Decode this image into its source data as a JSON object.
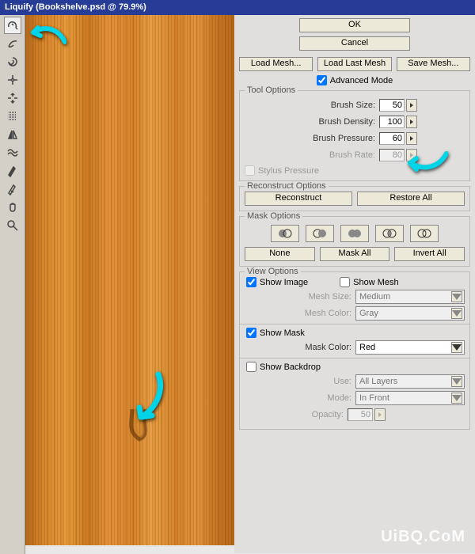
{
  "title": "Liquify (Bookshelve.psd @ 79.9%)",
  "buttons": {
    "ok": "OK",
    "cancel": "Cancel",
    "load_mesh": "Load Mesh...",
    "load_last_mesh": "Load Last Mesh",
    "save_mesh": "Save Mesh...",
    "reconstruct": "Reconstruct",
    "restore_all": "Restore All",
    "none": "None",
    "mask_all": "Mask All",
    "invert_all": "Invert All"
  },
  "advanced_mode_label": "Advanced Mode",
  "tool_options": {
    "legend": "Tool Options",
    "brush_size_label": "Brush Size:",
    "brush_size": "50",
    "brush_density_label": "Brush Density:",
    "brush_density": "100",
    "brush_pressure_label": "Brush Pressure:",
    "brush_pressure": "60",
    "brush_rate_label": "Brush Rate:",
    "brush_rate": "80",
    "stylus_label": "Stylus Pressure"
  },
  "reconstruct_options": {
    "legend": "Reconstruct Options"
  },
  "mask_options": {
    "legend": "Mask Options"
  },
  "view_options": {
    "legend": "View Options",
    "show_image": "Show Image",
    "show_mesh": "Show Mesh",
    "mesh_size_label": "Mesh Size:",
    "mesh_size": "Medium",
    "mesh_color_label": "Mesh Color:",
    "mesh_color": "Gray",
    "show_mask": "Show Mask",
    "mask_color_label": "Mask Color:",
    "mask_color": "Red",
    "show_backdrop": "Show Backdrop",
    "use_label": "Use:",
    "use": "All Layers",
    "mode_label": "Mode:",
    "mode": "In Front",
    "opacity_label": "Opacity:",
    "opacity": "50"
  },
  "tools": [
    {
      "name": "forward-warp-icon",
      "selected": true
    },
    {
      "name": "reconstruct-tool-icon"
    },
    {
      "name": "twirl-cw-icon"
    },
    {
      "name": "pucker-icon"
    },
    {
      "name": "bloat-icon"
    },
    {
      "name": "push-left-icon"
    },
    {
      "name": "mirror-icon"
    },
    {
      "name": "turbulence-icon"
    },
    {
      "name": "freeze-mask-icon"
    },
    {
      "name": "thaw-mask-icon"
    },
    {
      "name": "hand-tool-icon"
    },
    {
      "name": "zoom-tool-icon"
    }
  ],
  "watermark": "UiBQ.CoM"
}
